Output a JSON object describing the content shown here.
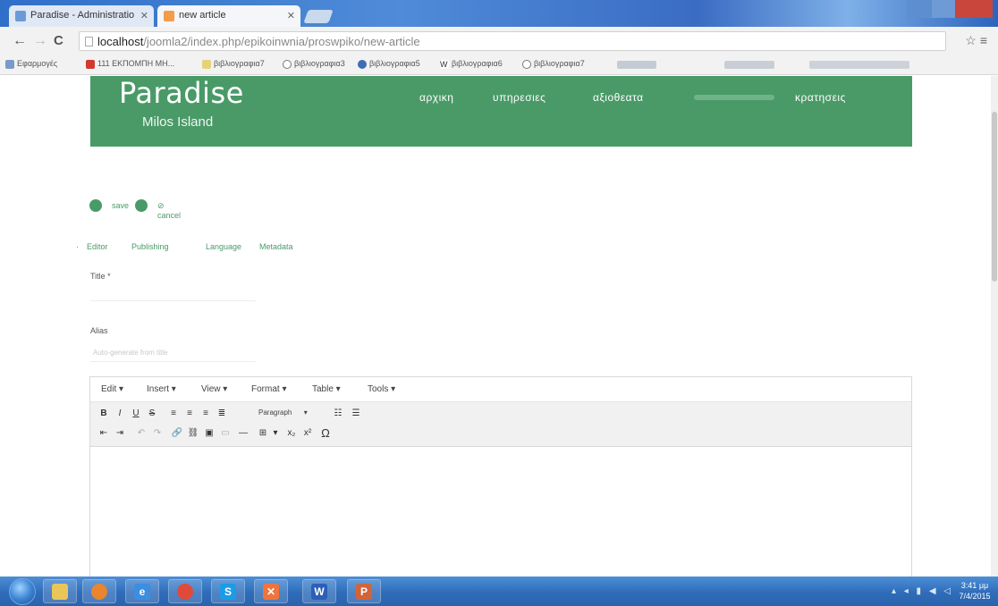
{
  "browser": {
    "tabs": [
      {
        "label": "Paradise - Administratio"
      },
      {
        "label": "new article"
      }
    ],
    "url_host": "localhost",
    "url_path": "/joomla2/index.php/epikoinwnia/proswpiko/new-article",
    "bookmarks": [
      {
        "label": "Εφαρμογές"
      },
      {
        "label": "111 ΕΚΠΟΜΠΗ ΜΗ..."
      },
      {
        "label": "βιβλιογραφια7"
      },
      {
        "label": "βιβλιογραφια3"
      },
      {
        "label": "βιβλιογραφια5"
      },
      {
        "label": "βιβλιογραφια6"
      },
      {
        "label": "βιβλιογραφια7"
      }
    ]
  },
  "site": {
    "brand_title": "Paradise",
    "brand_subtitle": "Milos Island",
    "nav": [
      "αρχικη",
      "υπηρεσιες",
      "αξιοθεατα",
      "κρατησεις"
    ]
  },
  "actions": {
    "save": "save",
    "cancel": "cancel"
  },
  "editor_tabs": [
    "Editor",
    "Publishing",
    "Language",
    "Metadata"
  ],
  "form": {
    "title_label": "Title *",
    "alias_label": "Alias",
    "alias_placeholder": "Auto-generate from title"
  },
  "editor": {
    "menus": [
      "Edit ▾",
      "Insert ▾",
      "View ▾",
      "Format ▾",
      "Table ▾",
      "Tools ▾"
    ],
    "format_select": "Paragraph",
    "toolbar_row1": [
      "B",
      "I",
      "U",
      "S"
    ],
    "toolbar_row2_glyphs": [
      "x₂",
      "x²",
      "Ω"
    ]
  },
  "taskbar": {
    "clock_time": "3:41 μμ",
    "clock_date": "7/4/2015"
  },
  "colors": {
    "brand_green": "#4a9a68",
    "taskbar_blue": "#2f6cb9"
  }
}
